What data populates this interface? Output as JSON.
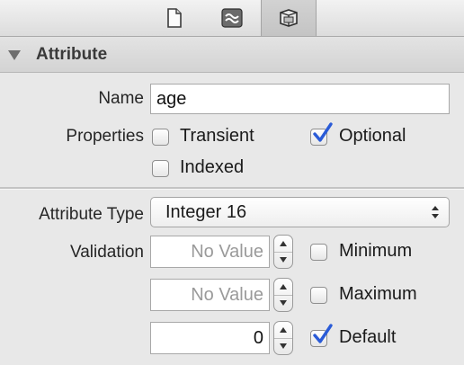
{
  "toolbar": {
    "buttons": [
      {
        "icon": "file-inspector-icon",
        "selected": false
      },
      {
        "icon": "quick-help-icon",
        "selected": false
      },
      {
        "icon": "data-model-inspector-icon",
        "selected": true
      }
    ]
  },
  "section": {
    "title": "Attribute",
    "expanded": true
  },
  "name": {
    "label": "Name",
    "value": "age"
  },
  "properties": {
    "label": "Properties",
    "transient": {
      "label": "Transient",
      "checked": false
    },
    "optional": {
      "label": "Optional",
      "checked": true
    },
    "indexed": {
      "label": "Indexed",
      "checked": false
    }
  },
  "attribute_type": {
    "label": "Attribute Type",
    "selected": "Integer 16"
  },
  "validation": {
    "label": "Validation",
    "minimum": {
      "placeholder": "No Value",
      "value": "",
      "label": "Minimum",
      "checked": false
    },
    "maximum": {
      "placeholder": "No Value",
      "value": "",
      "label": "Maximum",
      "checked": false
    },
    "default": {
      "value": "0",
      "label": "Default",
      "checked": true
    }
  },
  "colors": {
    "check_blue": "#2a5bd7"
  }
}
